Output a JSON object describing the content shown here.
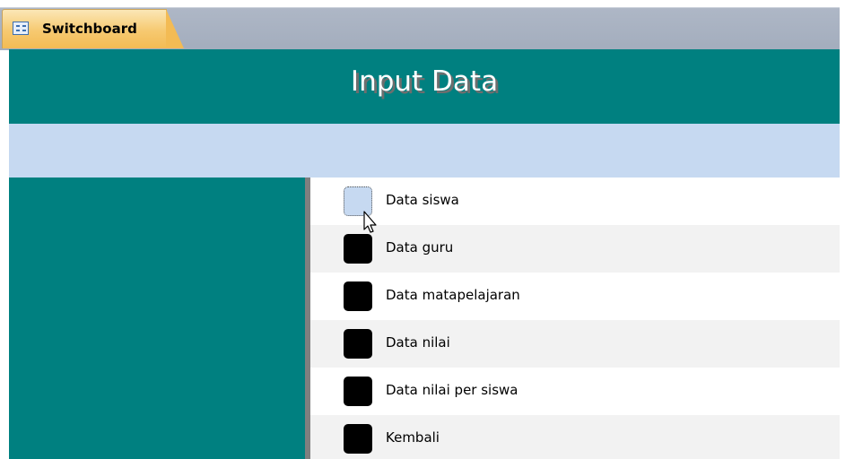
{
  "tab": {
    "label": "Switchboard",
    "icon": "form-icon"
  },
  "header": {
    "title": "Input Data"
  },
  "menu": {
    "items": [
      {
        "label": "Data siswa",
        "focused": true
      },
      {
        "label": "Data guru"
      },
      {
        "label": "Data matapelajaran"
      },
      {
        "label": "Data nilai"
      },
      {
        "label": "Data nilai per siswa"
      },
      {
        "label": "Kembali"
      }
    ]
  },
  "colors": {
    "teal": "#008080",
    "light_blue": "#c6d9f1",
    "tab_orange": "#f6c970"
  }
}
